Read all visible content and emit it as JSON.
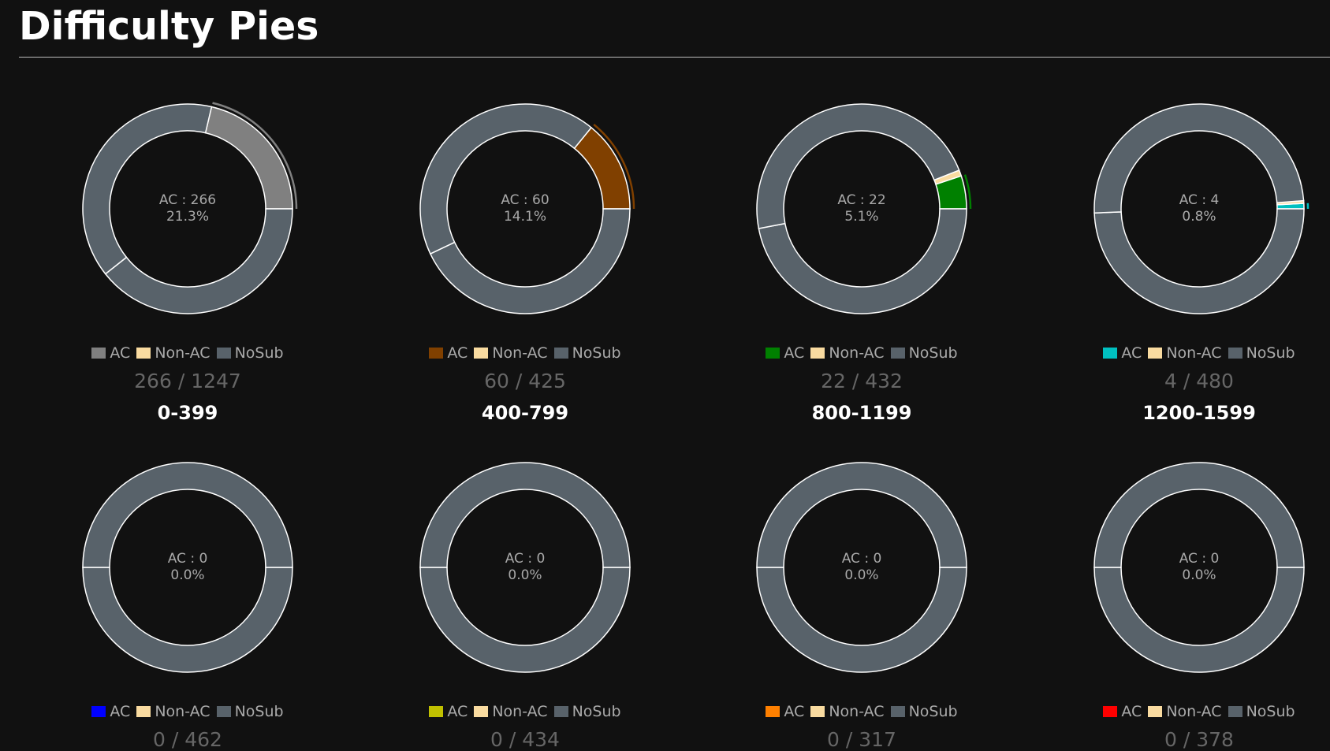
{
  "page": {
    "title": "Difficulty Pies"
  },
  "colors": {
    "background": "#111111",
    "nosub": "#58626a",
    "nonac": "#f9dba0",
    "border": "#ffffff"
  },
  "chart_data": [
    {
      "type": "pie",
      "range_label": "0-399",
      "ac": 266,
      "nonac": 0,
      "total": 1247,
      "percent_label": "21.3%",
      "ac_color": "#808080",
      "legend": [
        "AC",
        "Non-AC",
        "NoSub"
      ]
    },
    {
      "type": "pie",
      "range_label": "400-799",
      "ac": 60,
      "nonac": 0,
      "total": 425,
      "percent_label": "14.1%",
      "ac_color": "#804000",
      "legend": [
        "AC",
        "Non-AC",
        "NoSub"
      ]
    },
    {
      "type": "pie",
      "range_label": "800-1199",
      "ac": 22,
      "nonac": 4,
      "total": 432,
      "percent_label": "5.1%",
      "ac_color": "#008000",
      "legend": [
        "AC",
        "Non-AC",
        "NoSub"
      ]
    },
    {
      "type": "pie",
      "range_label": "1200-1599",
      "ac": 4,
      "nonac": 2,
      "total": 480,
      "percent_label": "0.8%",
      "ac_color": "#00c0c0",
      "legend": [
        "AC",
        "Non-AC",
        "NoSub"
      ]
    },
    {
      "type": "pie",
      "range_label": "",
      "ac": 0,
      "nonac": 0,
      "total": 462,
      "percent_label": "0.0%",
      "ac_color": "#0000ff",
      "legend": [
        "AC",
        "Non-AC",
        "NoSub"
      ]
    },
    {
      "type": "pie",
      "range_label": "",
      "ac": 0,
      "nonac": 0,
      "total": 434,
      "percent_label": "0.0%",
      "ac_color": "#c0c000",
      "legend": [
        "AC",
        "Non-AC",
        "NoSub"
      ]
    },
    {
      "type": "pie",
      "range_label": "",
      "ac": 0,
      "nonac": 0,
      "total": 317,
      "percent_label": "0.0%",
      "ac_color": "#ff8000",
      "legend": [
        "AC",
        "Non-AC",
        "NoSub"
      ]
    },
    {
      "type": "pie",
      "range_label": "",
      "ac": 0,
      "nonac": 0,
      "total": 378,
      "percent_label": "0.0%",
      "ac_color": "#ff0000",
      "legend": [
        "AC",
        "Non-AC",
        "NoSub"
      ]
    }
  ]
}
